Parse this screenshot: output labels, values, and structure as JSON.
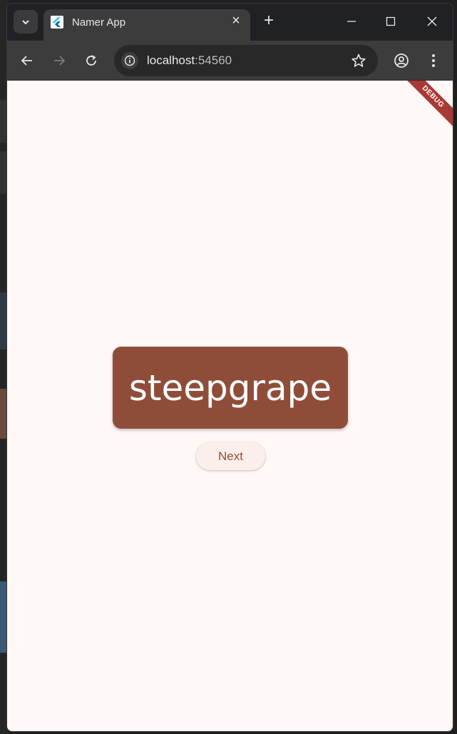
{
  "tab": {
    "title": "Namer App"
  },
  "omnibox": {
    "host": "localhost",
    "port": ":54560"
  },
  "debug_banner": "DEBUG",
  "app": {
    "word": "steepgrape",
    "next_label": "Next"
  },
  "colors": {
    "card": "#8f4d39",
    "page_bg": "#fff8f6",
    "debug": "#a83a36"
  }
}
